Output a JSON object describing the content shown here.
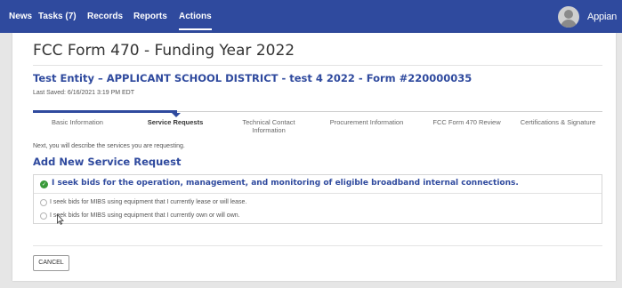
{
  "nav": {
    "items": [
      "News",
      "Tasks (7)",
      "Records",
      "Reports",
      "Actions"
    ],
    "active_index": 4,
    "brand": "Appian"
  },
  "page": {
    "title": "FCC Form 470 - Funding Year 2022",
    "entity": "Test Entity – APPLICANT SCHOOL DISTRICT - test 4 2022 - Form #220000035",
    "last_saved": "Last Saved: 6/16/2021 3:19 PM EDT"
  },
  "steps": {
    "items": [
      {
        "label": "Basic Information"
      },
      {
        "label": "Service Requests"
      },
      {
        "label": "Technical Contact Information"
      },
      {
        "label": "Procurement Information"
      },
      {
        "label": "FCC Form 470 Review"
      },
      {
        "label": "Certifications & Signature"
      }
    ],
    "active_index": 1
  },
  "main": {
    "intro": "Next, you will describe the services you are requesting.",
    "section_title": "Add New Service Request",
    "request": {
      "selected_label": "I seek bids for the operation, management, and monitoring of eligible broadband internal connections.",
      "options": [
        "I seek bids for MIBS using equipment that I currently lease or will lease.",
        "I seek bids for MIBS using equipment that I currently own or will own."
      ]
    },
    "cancel_label": "CANCEL"
  },
  "colors": {
    "nav_bg": "#2f4a9e",
    "accent": "#2f4a9e",
    "success": "#3a9a3a"
  },
  "icons": {
    "selected": "check-circle-icon",
    "user": "avatar-icon",
    "pointer": "mouse-pointer-icon"
  }
}
